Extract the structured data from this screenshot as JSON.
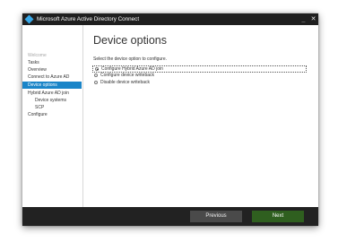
{
  "window": {
    "title": "Microsoft Azure Active Directory Connect",
    "minimize_glyph": "_",
    "close_glyph": "✕"
  },
  "sidebar": {
    "items": [
      {
        "label": "Welcome",
        "state": "disabled"
      },
      {
        "label": "Tasks",
        "state": "normal"
      },
      {
        "label": "Overview",
        "state": "normal"
      },
      {
        "label": "Connect to Azure AD",
        "state": "normal"
      },
      {
        "label": "Device options",
        "state": "active"
      },
      {
        "label": "Hybrid Azure AD join",
        "state": "normal"
      },
      {
        "label": "Device systems",
        "state": "normal"
      },
      {
        "label": "SCP",
        "state": "normal"
      },
      {
        "label": "Configure",
        "state": "normal"
      }
    ]
  },
  "main": {
    "title": "Device options",
    "instruction": "Select the device option to configure.",
    "options": [
      {
        "label": "Configure Hybrid Azure AD join",
        "selected": true
      },
      {
        "label": "Configure device writeback",
        "selected": false
      },
      {
        "label": "Disable device writeback",
        "selected": false
      }
    ]
  },
  "footer": {
    "previous_label": "Previous",
    "next_label": "Next"
  },
  "colors": {
    "accent": "#1a85c8",
    "next_button": "#2f5f1f",
    "footer_bg": "#222222",
    "titlebar_bg": "#1f1f1f"
  }
}
